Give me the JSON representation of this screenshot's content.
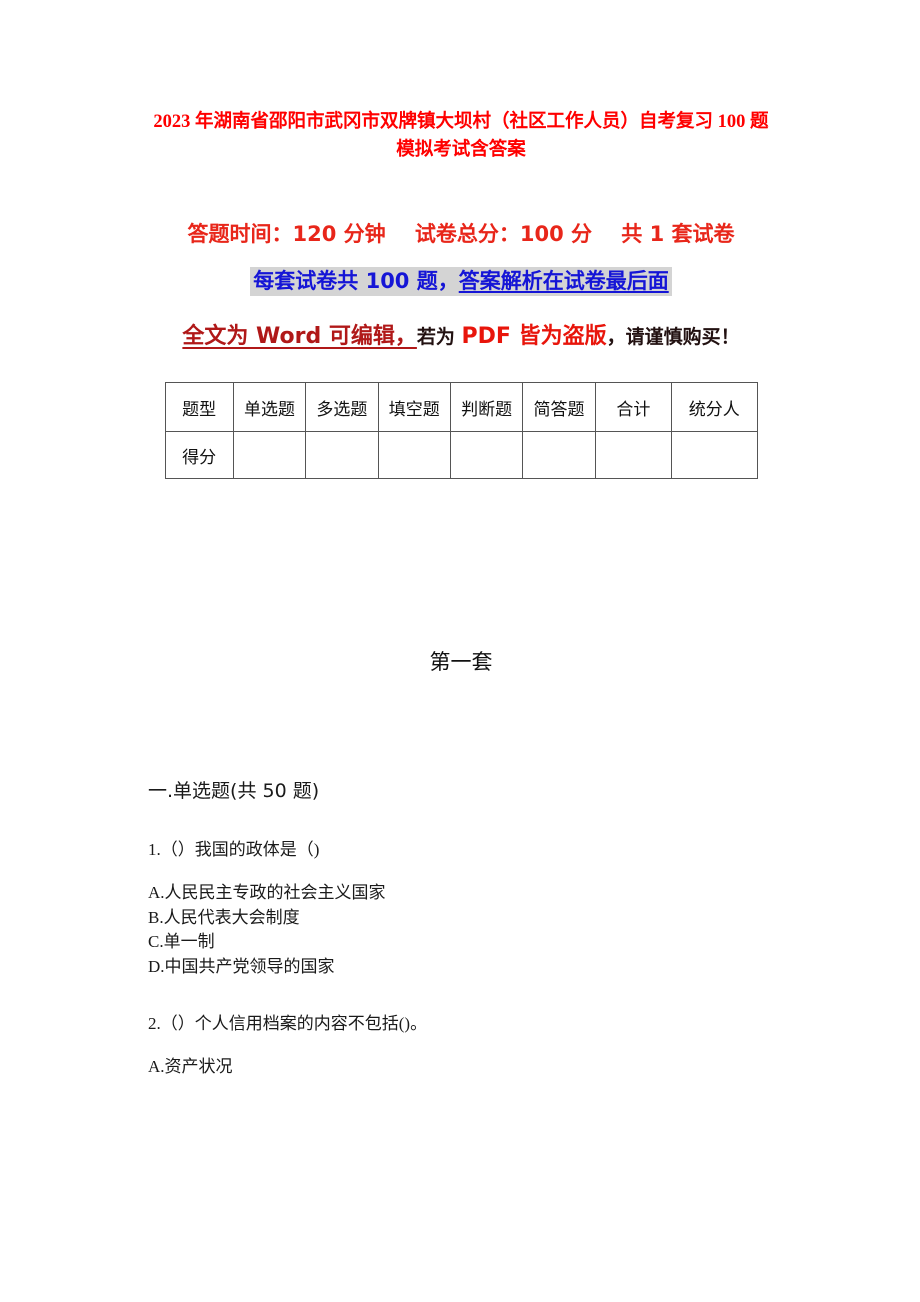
{
  "document": {
    "title": "2023 年湖南省邵阳市武冈市双牌镇大坝村（社区工作人员）自考复习 100 题模拟考试含答案",
    "title_color": "#FF0000"
  },
  "exam_info": {
    "line1": "答题时间：120 分钟    试卷总分：100 分    共 1 套试卷",
    "line1_color": "#E8261A",
    "line2_plain": "每套试卷共 100 题，",
    "line2_underlined": "答案解析在试卷最后面",
    "line2_color": "#1515D6",
    "line2_highlight": "#D4D4D4",
    "line3_part1": "全文为 Word 可编辑，",
    "line3_part2": "若为 ",
    "line3_part3": "PDF 皆为盗版",
    "line3_part4": "，请谨慎购买！",
    "line3_dark_red": "#B01818",
    "line3_bright_red": "#E8150B"
  },
  "score_table": {
    "headers": [
      "题型",
      "单选题",
      "多选题",
      "填空题",
      "判断题",
      "简答题",
      "合计",
      "统分人"
    ],
    "rows": [
      {
        "label": "得分",
        "values": [
          "",
          "",
          "",
          "",
          "",
          "",
          ""
        ]
      }
    ]
  },
  "set_heading": "第一套",
  "section": {
    "heading": "一.单选题(共 50 题)"
  },
  "questions": [
    {
      "stem": "1.（）我国的政体是（)",
      "options": [
        "A.人民民主专政的社会主义国家",
        "B.人民代表大会制度",
        "C.单一制",
        "D.中国共产党领导的国家"
      ]
    },
    {
      "stem": "2.（）个人信用档案的内容不包括()。",
      "options": [
        "A.资产状况"
      ]
    }
  ]
}
